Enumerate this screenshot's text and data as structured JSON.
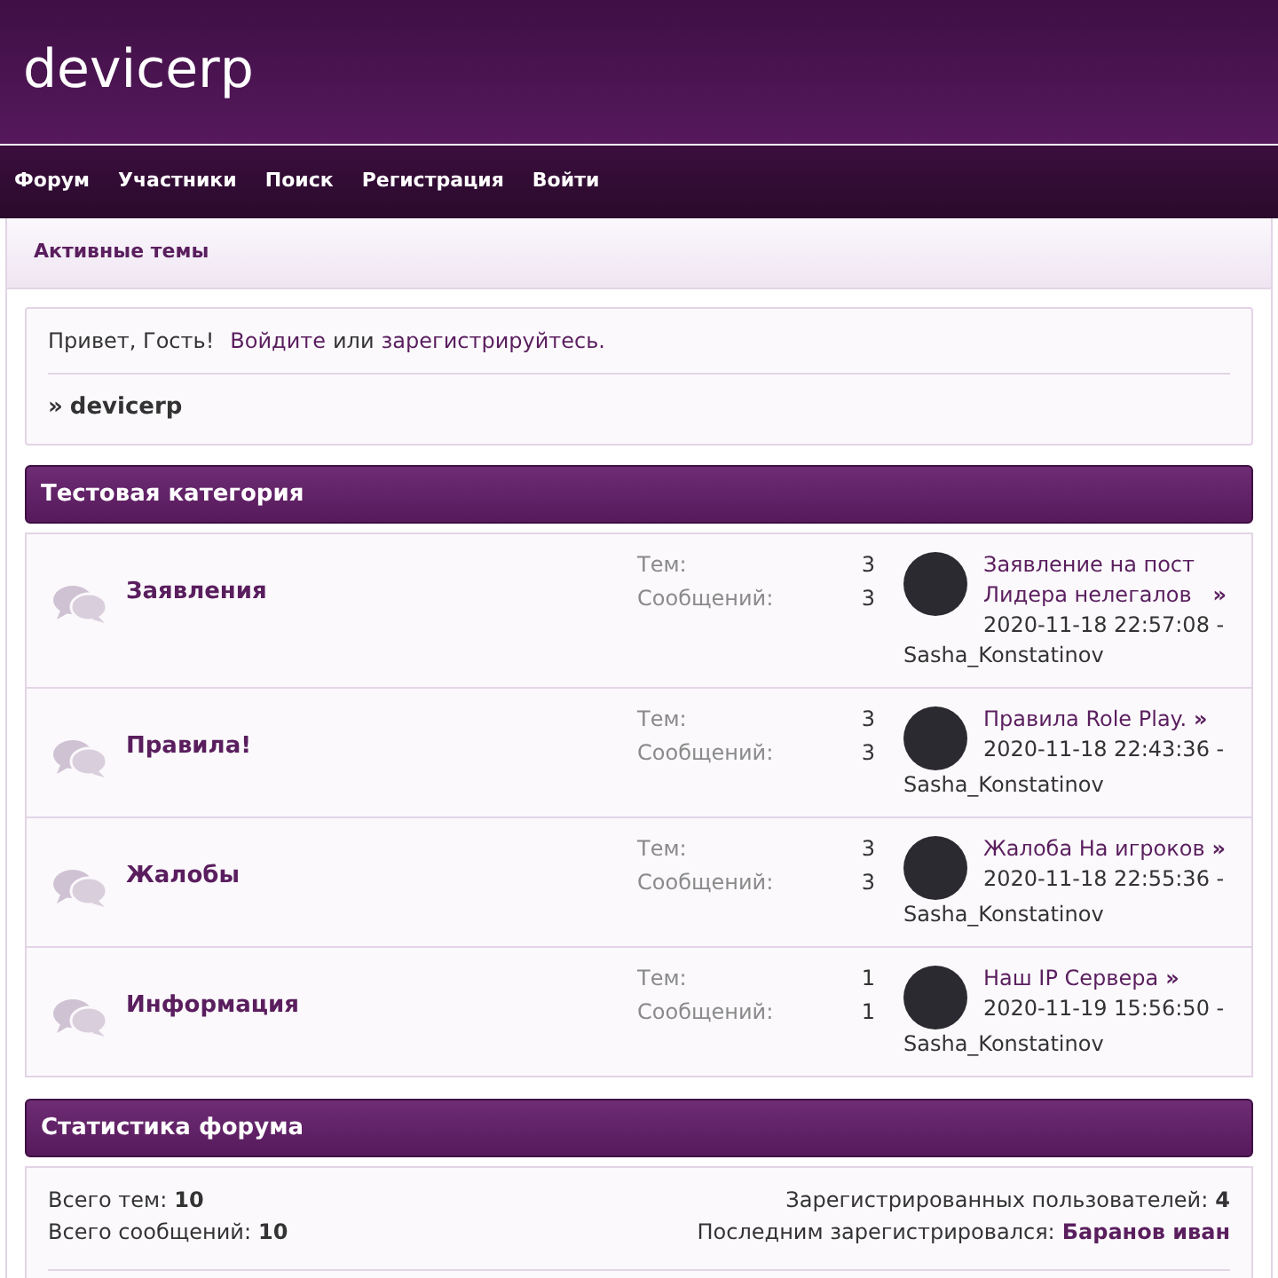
{
  "site_title": "devicerp",
  "nav": [
    {
      "label": "Форум"
    },
    {
      "label": "Участники"
    },
    {
      "label": "Поиск"
    },
    {
      "label": "Регистрация"
    },
    {
      "label": "Войти"
    }
  ],
  "subnav": {
    "label": "Активные темы"
  },
  "welcome": {
    "greeting": "Привет, Гость!",
    "login_link": "Войдите",
    "or": "или",
    "register_link": "зарегистрируйтесь.",
    "breadcrumb_arrow": "»",
    "breadcrumb": "devicerp"
  },
  "category": {
    "title": "Тестовая категория",
    "forums": [
      {
        "name": "Заявления",
        "topics_label": "Тем:",
        "topics": "3",
        "posts_label": "Сообщений:",
        "posts": "3",
        "last_title": "Заявление на пост Лидера нелегалов",
        "last_arrow": "»",
        "last_date": "2020-11-18 22:57:08 -",
        "last_author": "Sasha_Konstatinov"
      },
      {
        "name": "Правила!",
        "topics_label": "Тем:",
        "topics": "3",
        "posts_label": "Сообщений:",
        "posts": "3",
        "last_title": "Правила Role Play.",
        "last_arrow": "»",
        "last_date": "2020-11-18 22:43:36 -",
        "last_author": "Sasha_Konstatinov"
      },
      {
        "name": "Жалобы",
        "topics_label": "Тем:",
        "topics": "3",
        "posts_label": "Сообщений:",
        "posts": "3",
        "last_title": "Жалоба На игроков",
        "last_arrow": "»",
        "last_date": "2020-11-18 22:55:36 -",
        "last_author": "Sasha_Konstatinov"
      },
      {
        "name": "Информация",
        "topics_label": "Тем:",
        "topics": "1",
        "posts_label": "Сообщений:",
        "posts": "1",
        "last_title": "Наш IP Сервера",
        "last_arrow": "»",
        "last_date": "2020-11-19 15:56:50 -",
        "last_author": "Sasha_Konstatinov"
      }
    ]
  },
  "stats": {
    "title": "Статистика форума",
    "left": [
      {
        "label": "Всего тем:",
        "value": "10"
      },
      {
        "label": "Всего сообщений:",
        "value": "10"
      }
    ],
    "right": [
      {
        "label": "Зарегистрированных пользователей:",
        "value": "4",
        "kind": "plain"
      },
      {
        "label": "Последним зарегистрировался:",
        "value": "Баранов иван",
        "kind": "link"
      }
    ]
  }
}
